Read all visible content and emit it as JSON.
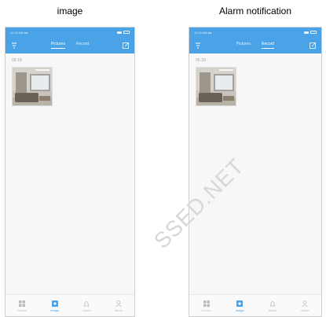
{
  "captions": {
    "left": "image",
    "right": "Alarm notification"
  },
  "status": {
    "left": "11:24 AM  ●●",
    "right": ""
  },
  "tabs": [
    "Pictures",
    "Record"
  ],
  "active_tab_index": 0,
  "date_label": "05-18",
  "bottom_nav": [
    "Device",
    "Image",
    "Alarm",
    "About"
  ],
  "active_nav_index": 1,
  "watermark": "SSED.NET",
  "colors": {
    "accent": "#4aa3e6",
    "background": "#f7f7f7"
  },
  "icons": {
    "back": "filter-icon",
    "edit": "edit-icon",
    "nav": [
      "grid-icon",
      "image-icon",
      "bell-icon",
      "person-icon"
    ]
  }
}
